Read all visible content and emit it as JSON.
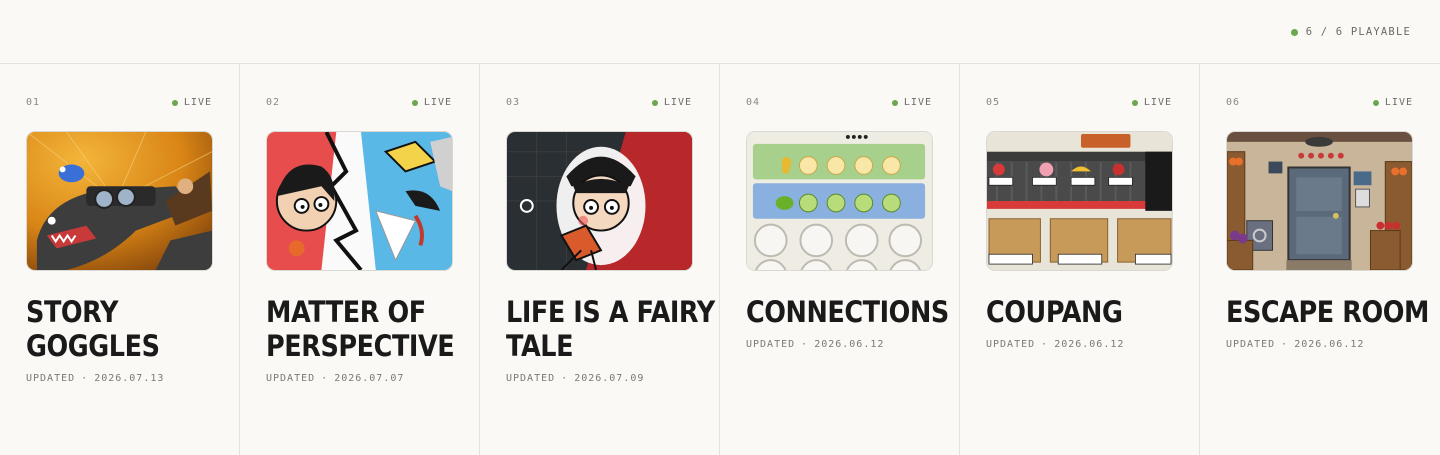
{
  "header": {
    "status_text": "6 / 6 PLAYABLE",
    "status_color": "#6aa84f"
  },
  "games": [
    {
      "number": "01",
      "status": "LIVE",
      "title": "STORY GOGGLES",
      "updated_label": "UPDATED",
      "separator": "·",
      "date": "2026.07.13",
      "thumbnail": "story-goggles-art"
    },
    {
      "number": "02",
      "status": "LIVE",
      "title": "MATTER OF PERSPECTIVE",
      "updated_label": "UPDATED",
      "separator": "·",
      "date": "2026.07.07",
      "thumbnail": "matter-of-perspective-art"
    },
    {
      "number": "03",
      "status": "LIVE",
      "title": "LIFE IS A FAIRY TALE",
      "updated_label": "UPDATED",
      "separator": "·",
      "date": "2026.07.09",
      "thumbnail": "fairy-tale-art"
    },
    {
      "number": "04",
      "status": "LIVE",
      "title": "CONNECTIONS",
      "updated_label": "UPDATED",
      "separator": "·",
      "date": "2026.06.12",
      "thumbnail": "connections-art"
    },
    {
      "number": "05",
      "status": "LIVE",
      "title": "COUPANG",
      "updated_label": "UPDATED",
      "separator": "·",
      "date": "2026.06.12",
      "thumbnail": "coupang-art"
    },
    {
      "number": "06",
      "status": "LIVE",
      "title": "ESCAPE ROOM",
      "updated_label": "UPDATED",
      "separator": "·",
      "date": "2026.06.12",
      "thumbnail": "escape-room-art"
    }
  ]
}
